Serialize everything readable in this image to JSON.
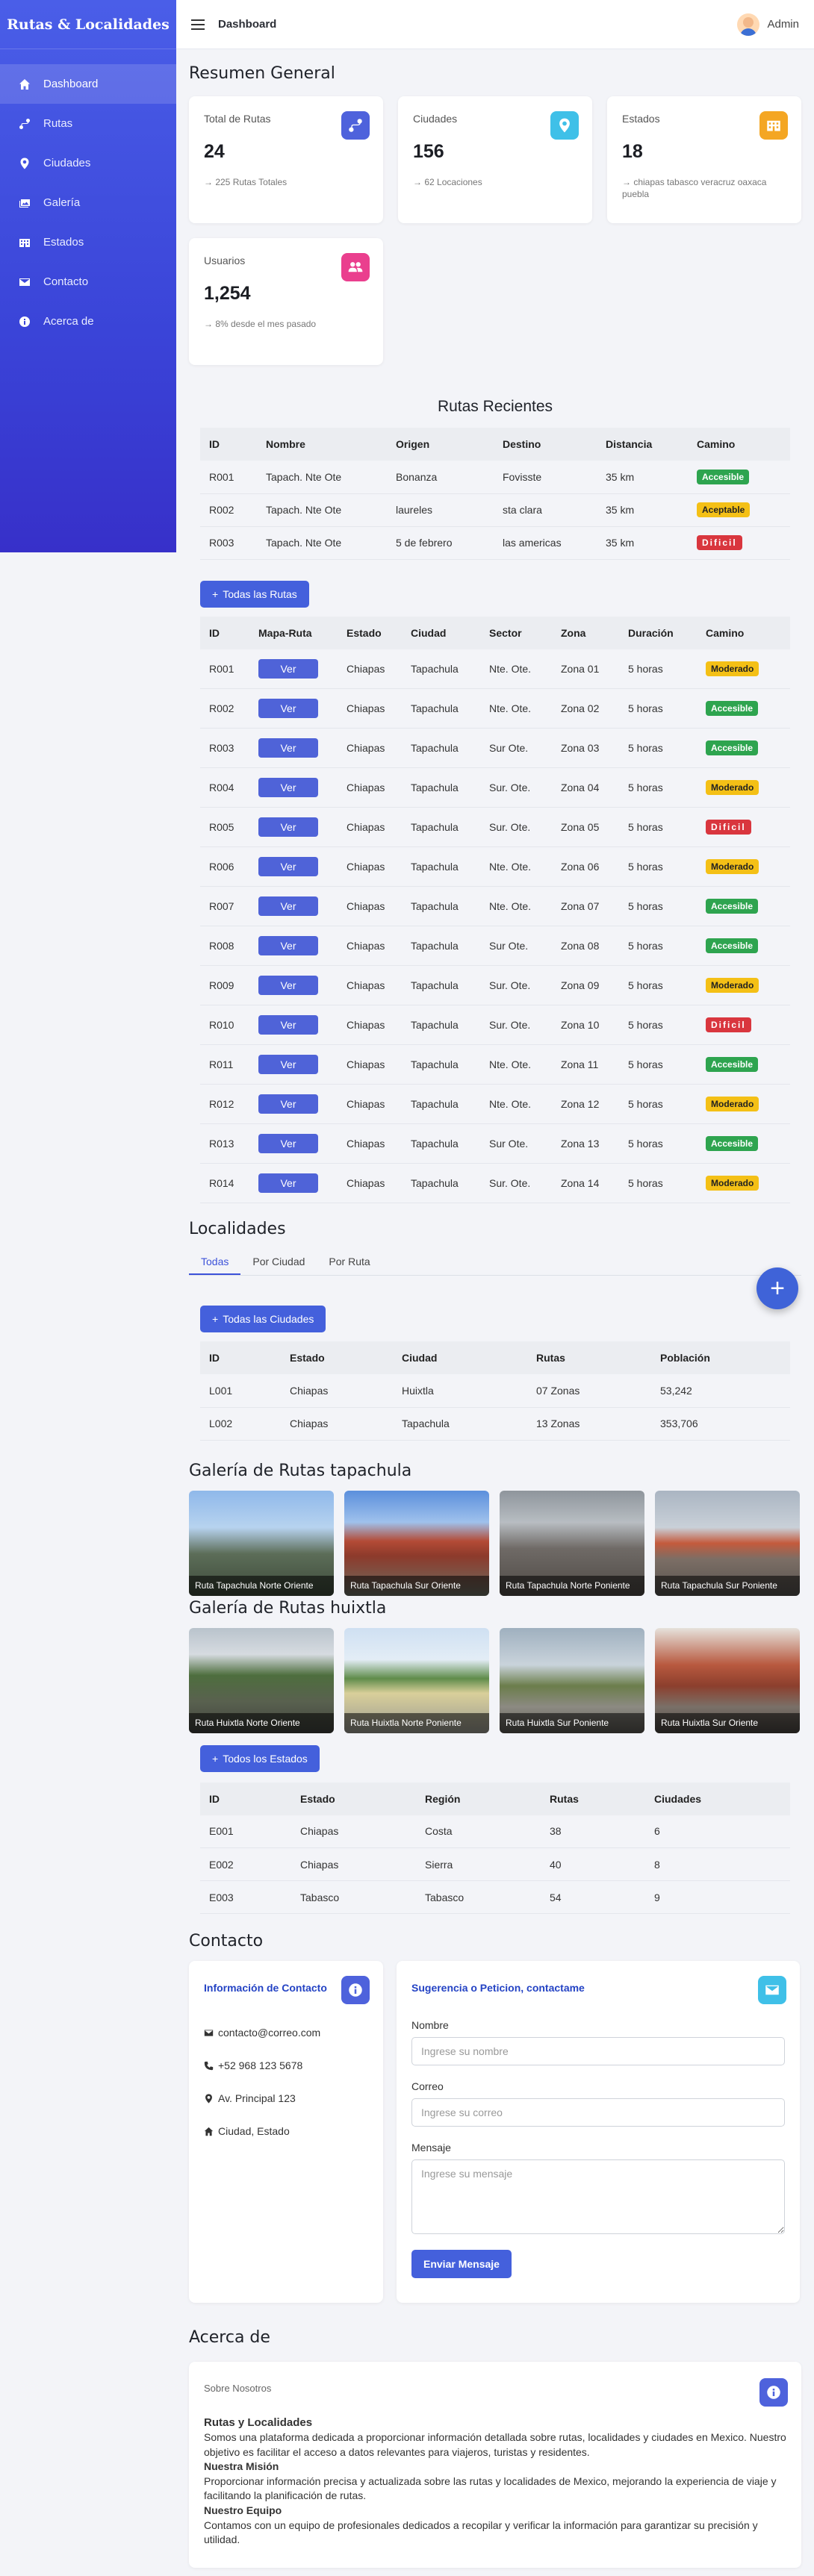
{
  "sidebar": {
    "brand": "Rutas & Localidades",
    "items": [
      {
        "label": "Dashboard",
        "icon": "home-icon"
      },
      {
        "label": "Rutas",
        "icon": "route-icon"
      },
      {
        "label": "Ciudades",
        "icon": "map-pin-icon"
      },
      {
        "label": "Galería",
        "icon": "images-icon"
      },
      {
        "label": "Estados",
        "icon": "building-icon"
      },
      {
        "label": "Contacto",
        "icon": "envelope-icon"
      },
      {
        "label": "Acerca de",
        "icon": "info-icon"
      }
    ]
  },
  "topbar": {
    "title": "Dashboard",
    "user": "Admin"
  },
  "summary": {
    "title": "Resumen General",
    "cards": [
      {
        "label": "Total de Rutas",
        "value": "24",
        "sub": "→ 225 Rutas Totales",
        "color": "#4e62dc"
      },
      {
        "label": "Ciudades",
        "value": "156",
        "sub": "→ 62 Locaciones",
        "color": "#3fc0e8"
      },
      {
        "label": "Estados",
        "value": "18",
        "sub": "→ chiapas tabasco veracruz oaxaca puebla",
        "color": "#f4a623"
      },
      {
        "label": "Usuarios",
        "value": "1,254",
        "sub": "→ 8% desde el mes pasado",
        "color": "#ea3f8e"
      }
    ]
  },
  "recent": {
    "title": "Rutas Recientes",
    "headers": [
      "ID",
      "Nombre",
      "Origen",
      "Destino",
      "Distancia",
      "Camino"
    ],
    "rows": [
      [
        "R001",
        "Tapach. Nte Ote",
        "Bonanza",
        "Fovisste",
        "35 km",
        "Accesible"
      ],
      [
        "R002",
        "Tapach. Nte Ote",
        "laureles",
        "sta clara",
        "35 km",
        "Aceptable"
      ],
      [
        "R003",
        "Tapach. Nte Ote",
        "5 de febrero",
        "las americas",
        "35 km",
        "Dificil"
      ]
    ]
  },
  "routes": {
    "button": "Todas las Rutas",
    "headers": [
      "ID",
      "Mapa-Ruta",
      "Estado",
      "Ciudad",
      "Sector",
      "Zona",
      "Duración",
      "Camino"
    ],
    "ver_label": "Ver",
    "rows": [
      [
        "R001",
        "Chiapas",
        "Tapachula",
        "Nte. Ote.",
        "Zona 01",
        "5 horas",
        "Moderado"
      ],
      [
        "R002",
        "Chiapas",
        "Tapachula",
        "Nte. Ote.",
        "Zona 02",
        "5 horas",
        "Accesible"
      ],
      [
        "R003",
        "Chiapas",
        "Tapachula",
        "Sur Ote.",
        "Zona 03",
        "5 horas",
        "Accesible"
      ],
      [
        "R004",
        "Chiapas",
        "Tapachula",
        "Sur. Ote.",
        "Zona 04",
        "5 horas",
        "Moderado"
      ],
      [
        "R005",
        "Chiapas",
        "Tapachula",
        "Sur. Ote.",
        "Zona 05",
        "5 horas",
        "Dificil"
      ],
      [
        "R006",
        "Chiapas",
        "Tapachula",
        "Nte. Ote.",
        "Zona 06",
        "5 horas",
        "Moderado"
      ],
      [
        "R007",
        "Chiapas",
        "Tapachula",
        "Nte. Ote.",
        "Zona 07",
        "5 horas",
        "Accesible"
      ],
      [
        "R008",
        "Chiapas",
        "Tapachula",
        "Sur Ote.",
        "Zona 08",
        "5 horas",
        "Accesible"
      ],
      [
        "R009",
        "Chiapas",
        "Tapachula",
        "Sur. Ote.",
        "Zona 09",
        "5 horas",
        "Moderado"
      ],
      [
        "R010",
        "Chiapas",
        "Tapachula",
        "Sur. Ote.",
        "Zona 10",
        "5 horas",
        "Dificil"
      ],
      [
        "R011",
        "Chiapas",
        "Tapachula",
        "Nte. Ote.",
        "Zona 11",
        "5 horas",
        "Accesible"
      ],
      [
        "R012",
        "Chiapas",
        "Tapachula",
        "Nte. Ote.",
        "Zona 12",
        "5 horas",
        "Moderado"
      ],
      [
        "R013",
        "Chiapas",
        "Tapachula",
        "Sur Ote.",
        "Zona 13",
        "5 horas",
        "Accesible"
      ],
      [
        "R014",
        "Chiapas",
        "Tapachula",
        "Sur. Ote.",
        "Zona 14",
        "5 horas",
        "Moderado"
      ]
    ]
  },
  "localidades": {
    "title": "Localidades",
    "tabs": [
      "Todas",
      "Por Ciudad",
      "Por Ruta"
    ],
    "button": "Todas las Ciudades",
    "headers": [
      "ID",
      "Estado",
      "Ciudad",
      "Rutas",
      "Población"
    ],
    "rows": [
      [
        "L001",
        "Chiapas",
        "Huixtla",
        "07 Zonas",
        "53,242"
      ],
      [
        "L002",
        "Chiapas",
        "Tapachula",
        "13 Zonas",
        "353,706"
      ]
    ]
  },
  "gallery_tap": {
    "title": "Galería de Rutas tapachula",
    "items": [
      "Ruta Tapachula Norte Oriente",
      "Ruta Tapachula Sur Oriente",
      "Ruta Tapachula Norte Poniente",
      "Ruta Tapachula Sur Poniente"
    ]
  },
  "gallery_hux": {
    "title": "Galería de Rutas huixtla",
    "items": [
      "Ruta Huixtla Norte Oriente",
      "Ruta Huixtla Norte Poniente",
      "Ruta Huixtla Sur Poniente",
      "Ruta Huixtla Sur Oriente"
    ]
  },
  "estados": {
    "button": "Todos los Estados",
    "headers": [
      "ID",
      "Estado",
      "Región",
      "Rutas",
      "Ciudades"
    ],
    "rows": [
      [
        "E001",
        "Chiapas",
        "Costa",
        "38",
        "6"
      ],
      [
        "E002",
        "Chiapas",
        "Sierra",
        "40",
        "8"
      ],
      [
        "E003",
        "Tabasco",
        "Tabasco",
        "54",
        "9"
      ]
    ]
  },
  "contacto": {
    "title": "Contacto",
    "info_title": "Información de Contacto",
    "email": "contacto@correo.com",
    "phone": "+52 968 123 5678",
    "address": "Av. Principal 123",
    "city": "Ciudad, Estado",
    "form_title": "Sugerencia o Peticion, contactame",
    "name_label": "Nombre",
    "name_placeholder": "Ingrese su nombre",
    "mail_label": "Correo",
    "mail_placeholder": "Ingrese su correo",
    "msg_label": "Mensaje",
    "msg_placeholder": "Ingrese su mensaje",
    "submit": "Enviar Mensaje"
  },
  "acerca": {
    "title": "Acerca de",
    "card_label": "Sobre Nosotros",
    "h1": "Rutas y Localidades",
    "p1": "Somos una plataforma dedicada a proporcionar información detallada sobre rutas, localidades y ciudades en Mexico. Nuestro objetivo es facilitar el acceso a datos relevantes para viajeros, turistas y residentes.",
    "h2": "Nuestra Misión",
    "p2": "Proporcionar información precisa y actualizada sobre las rutas y localidades de Mexico, mejorando la experiencia de viaje y facilitando la planificación de rutas.",
    "h3": "Nuestro Equipo",
    "p3": "Contamos con un equipo de profesionales dedicados a recopilar y verificar la información para garantizar su precisión y utilidad."
  },
  "colors": {
    "primary": "#4460dc",
    "accesible": "#2ea44f",
    "moderado": "#f4c016",
    "dificil": "#d9363e"
  }
}
